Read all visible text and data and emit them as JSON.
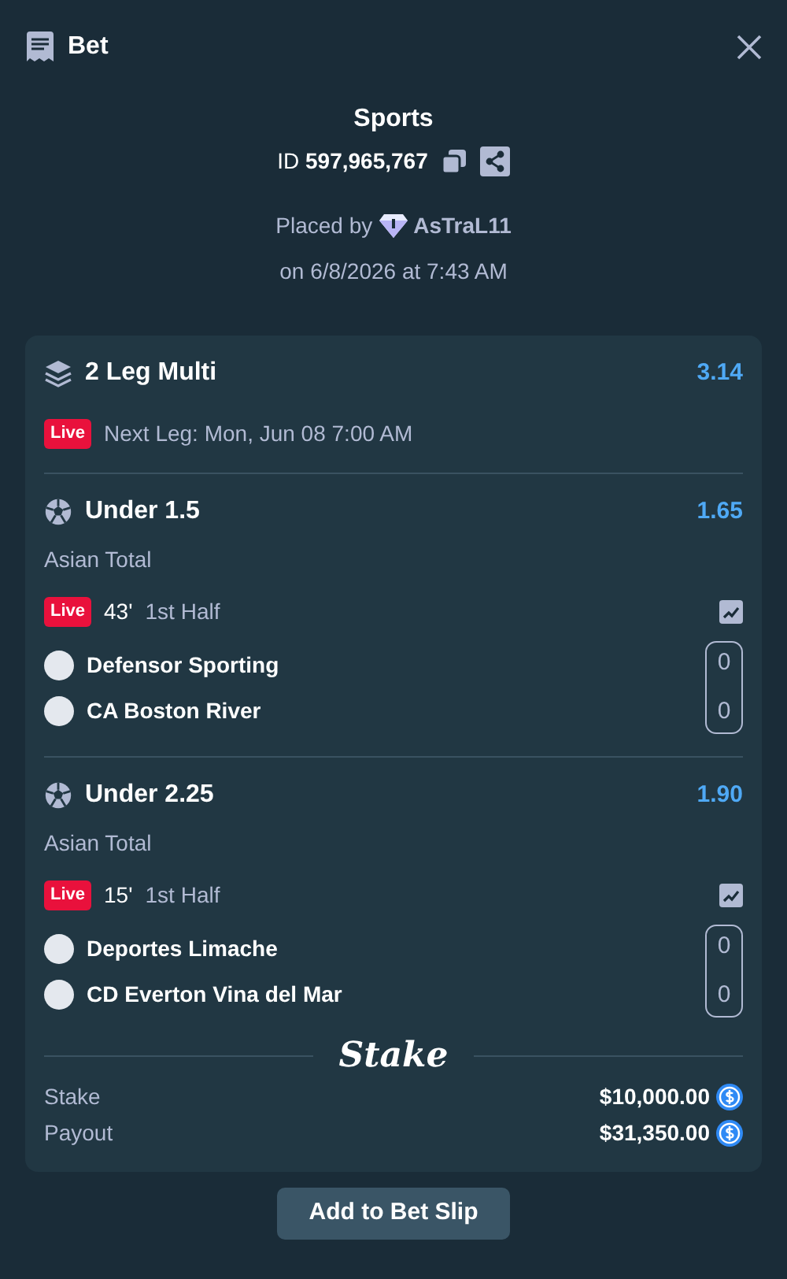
{
  "header": {
    "title": "Bet"
  },
  "summary": {
    "category": "Sports",
    "id_label": "ID",
    "id_value": "597,965,767",
    "placed_by_label": "Placed by",
    "user": "AsTraL11",
    "placed_on": "on 6/8/2026 at 7:43 AM"
  },
  "multi": {
    "title": "2 Leg Multi",
    "odds": "3.14",
    "live_badge": "Live",
    "next_leg": "Next Leg: Mon, Jun 08 7:00 AM"
  },
  "legs": [
    {
      "title": "Under 1.5",
      "odds": "1.65",
      "market": "Asian Total",
      "live_badge": "Live",
      "minute": "43'",
      "period": "1st Half",
      "teams": [
        {
          "name": "Defensor Sporting",
          "score": "0"
        },
        {
          "name": "CA Boston River",
          "score": "0"
        }
      ]
    },
    {
      "title": "Under 2.25",
      "odds": "1.90",
      "market": "Asian Total",
      "live_badge": "Live",
      "minute": "15'",
      "period": "1st Half",
      "teams": [
        {
          "name": "Deportes Limache",
          "score": "0"
        },
        {
          "name": "CD Everton Vina del Mar",
          "score": "0"
        }
      ]
    }
  ],
  "brand": "Stake",
  "totals": [
    {
      "label": "Stake",
      "amount": "$10,000.00"
    },
    {
      "label": "Payout",
      "amount": "$31,350.00"
    }
  ],
  "button": "Add to Bet Slip"
}
